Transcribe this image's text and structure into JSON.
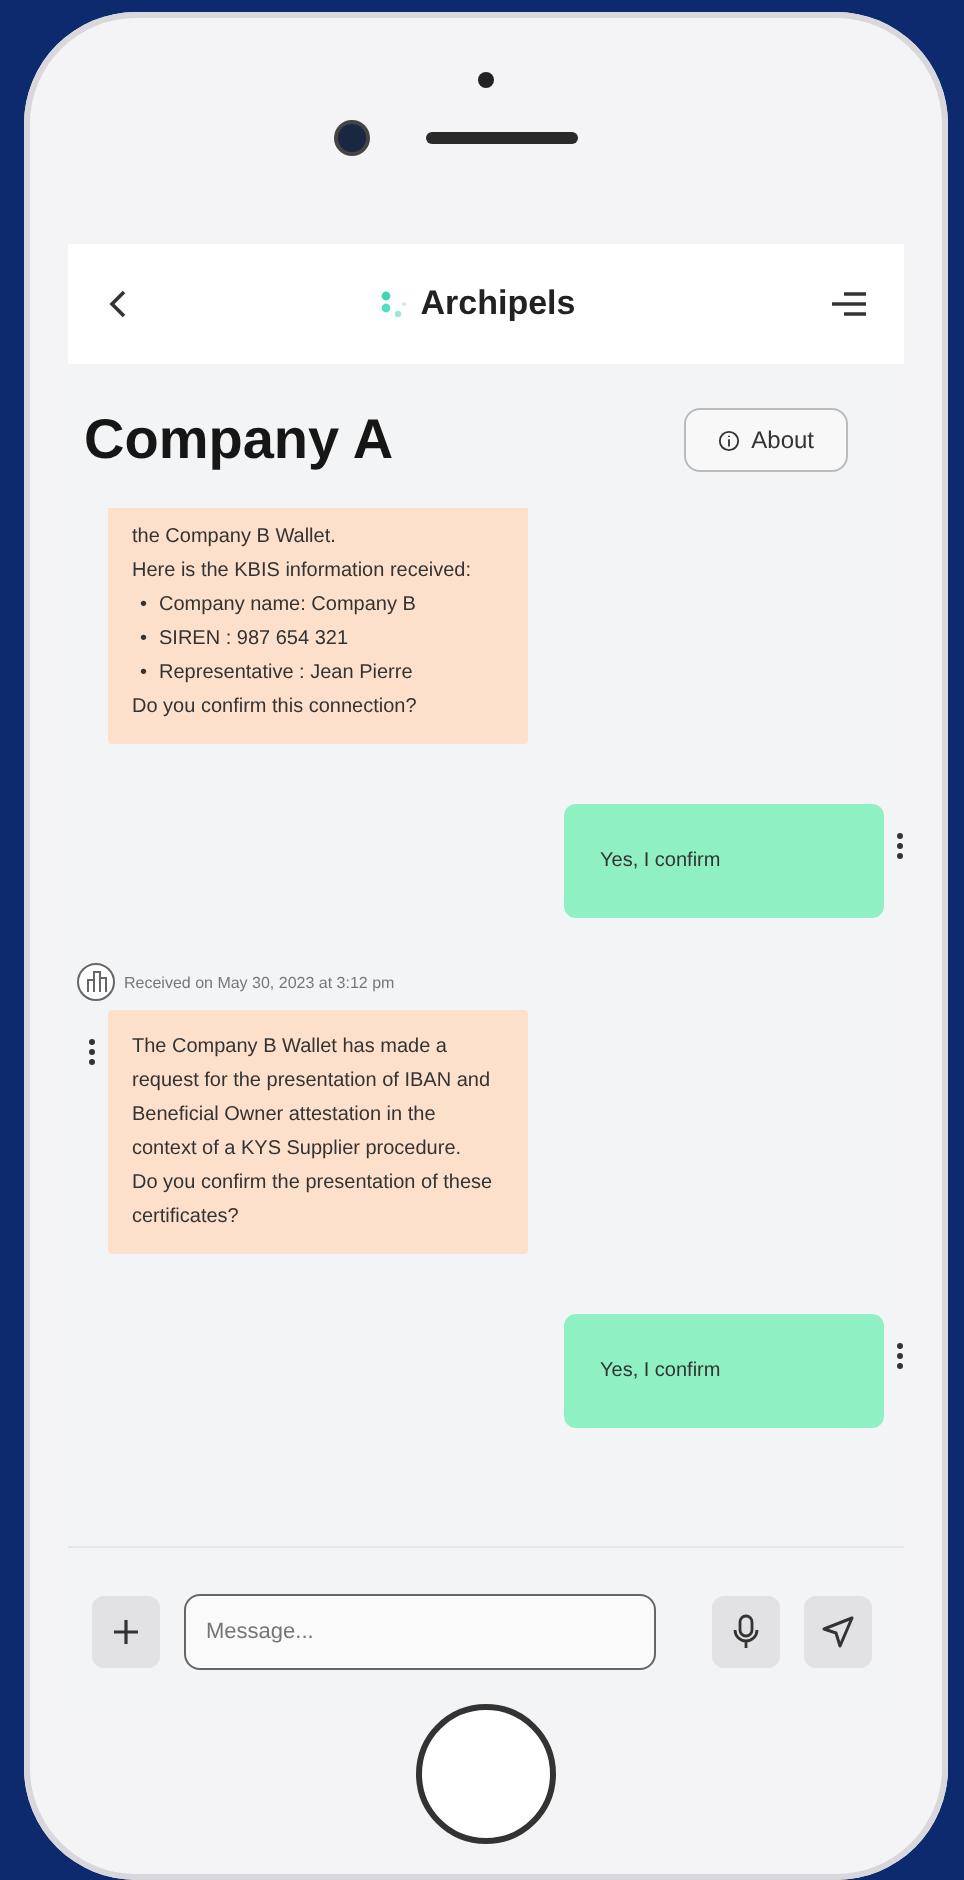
{
  "header": {
    "logo": "Archipels"
  },
  "title": "Company A",
  "about_button": "About",
  "messages": [
    {
      "kind": "received",
      "menu": false,
      "blocks": [
        {
          "kind": "text",
          "text": "the Company B Wallet."
        },
        {
          "kind": "text",
          "text": "Here is the KBIS information received:"
        },
        {
          "kind": "list",
          "marker": "•",
          "items": [
            "Company name: Company B",
            "SIREN : 987 654 321",
            "Representative : Jean Pierre"
          ]
        },
        {
          "kind": "text",
          "text": "Do you confirm this connection?"
        }
      ]
    },
    {
      "kind": "sent",
      "menu": true,
      "blocks": [
        {
          "kind": "text",
          "text": "Yes, I confirm"
        }
      ]
    },
    {
      "kind": "received",
      "menu": true,
      "meta": "Received on May 30, 2023 at 3:12 pm",
      "blocks": [
        {
          "kind": "text",
          "text": "The Company B Wallet has made a request for the presentation of IBAN and Beneficial Owner attestation in the context of a KYS Supplier procedure."
        },
        {
          "kind": "text",
          "text": "Do you confirm the presentation of these certificates?"
        }
      ]
    },
    {
      "kind": "sent",
      "menu": true,
      "blocks": [
        {
          "kind": "text",
          "text": "Yes, I confirm"
        }
      ]
    }
  ],
  "composer": {
    "placeholder": "Message..."
  }
}
